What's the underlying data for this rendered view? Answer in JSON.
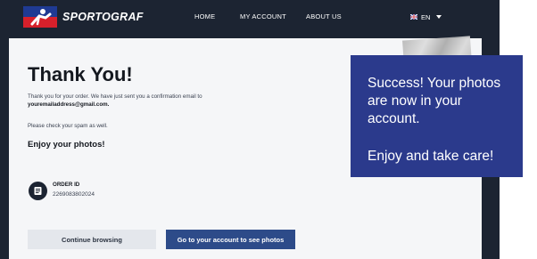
{
  "nav": {
    "brand": "SPORTOGRAF",
    "links": [
      "HOME",
      "MY ACCOUNT",
      "ABOUT US"
    ],
    "language": "EN"
  },
  "main": {
    "title": "Thank You!",
    "message": "Thank you for your order. We have just sent you a confirmation email to",
    "email": "youremailaddress@gmail.com.",
    "spam_note": "Please check your spam as well.",
    "enjoy": "Enjoy your photos!",
    "order_label": "ORDER ID",
    "order_id": "2269083802024",
    "buttons": {
      "continue": "Continue browsing",
      "account": "Go to your account to see photos"
    }
  },
  "callout": {
    "lines": [
      "Success! Your photos",
      "are now in your",
      "account.",
      "Enjoy and take care!"
    ]
  },
  "colors": {
    "nav_bg": "#1c2432",
    "primary_button": "#2d4b89",
    "callout_bg": "#2b3a8c"
  }
}
